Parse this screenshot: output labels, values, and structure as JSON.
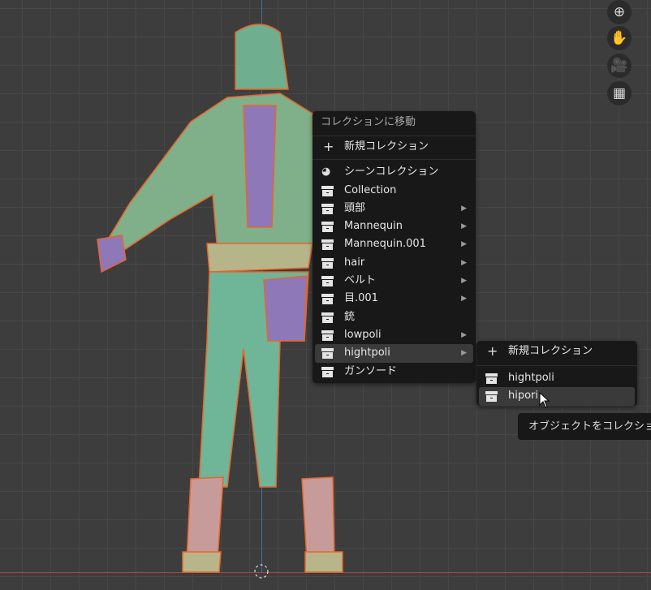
{
  "nav_gizmo": [
    {
      "icon": "zoom-icon"
    },
    {
      "icon": "hand-pan-icon"
    },
    {
      "icon": "camera-icon"
    },
    {
      "icon": "grid-icon"
    }
  ],
  "menu": {
    "title": "コレクションに移動",
    "new_collection": "新規コレクション",
    "items": [
      {
        "label": "シーンコレクション",
        "icon": "scene-collection-icon",
        "submenu": false
      },
      {
        "label": "Collection",
        "icon": "collection-icon",
        "submenu": false
      },
      {
        "label": "頭部",
        "icon": "collection-icon",
        "submenu": true
      },
      {
        "label": "Mannequin",
        "icon": "collection-icon",
        "submenu": true
      },
      {
        "label": "Mannequin.001",
        "icon": "collection-icon",
        "submenu": true
      },
      {
        "label": "hair",
        "icon": "collection-icon",
        "submenu": true
      },
      {
        "label": "ベルト",
        "icon": "collection-icon",
        "submenu": true
      },
      {
        "label": "目.001",
        "icon": "collection-icon",
        "submenu": true
      },
      {
        "label": "銃",
        "icon": "collection-icon",
        "submenu": false
      },
      {
        "label": "lowpoli",
        "icon": "collection-icon",
        "submenu": true
      },
      {
        "label": "hightpoli",
        "icon": "collection-icon",
        "submenu": true,
        "highlighted": true
      },
      {
        "label": "ガンソード",
        "icon": "collection-icon",
        "submenu": false
      }
    ]
  },
  "submenu": {
    "new_collection": "新規コレクション",
    "items": [
      {
        "label": "hightpoli"
      },
      {
        "label": "hipori",
        "highlighted": true
      }
    ]
  },
  "tooltip": "オブジェクトをコレクションに移動"
}
